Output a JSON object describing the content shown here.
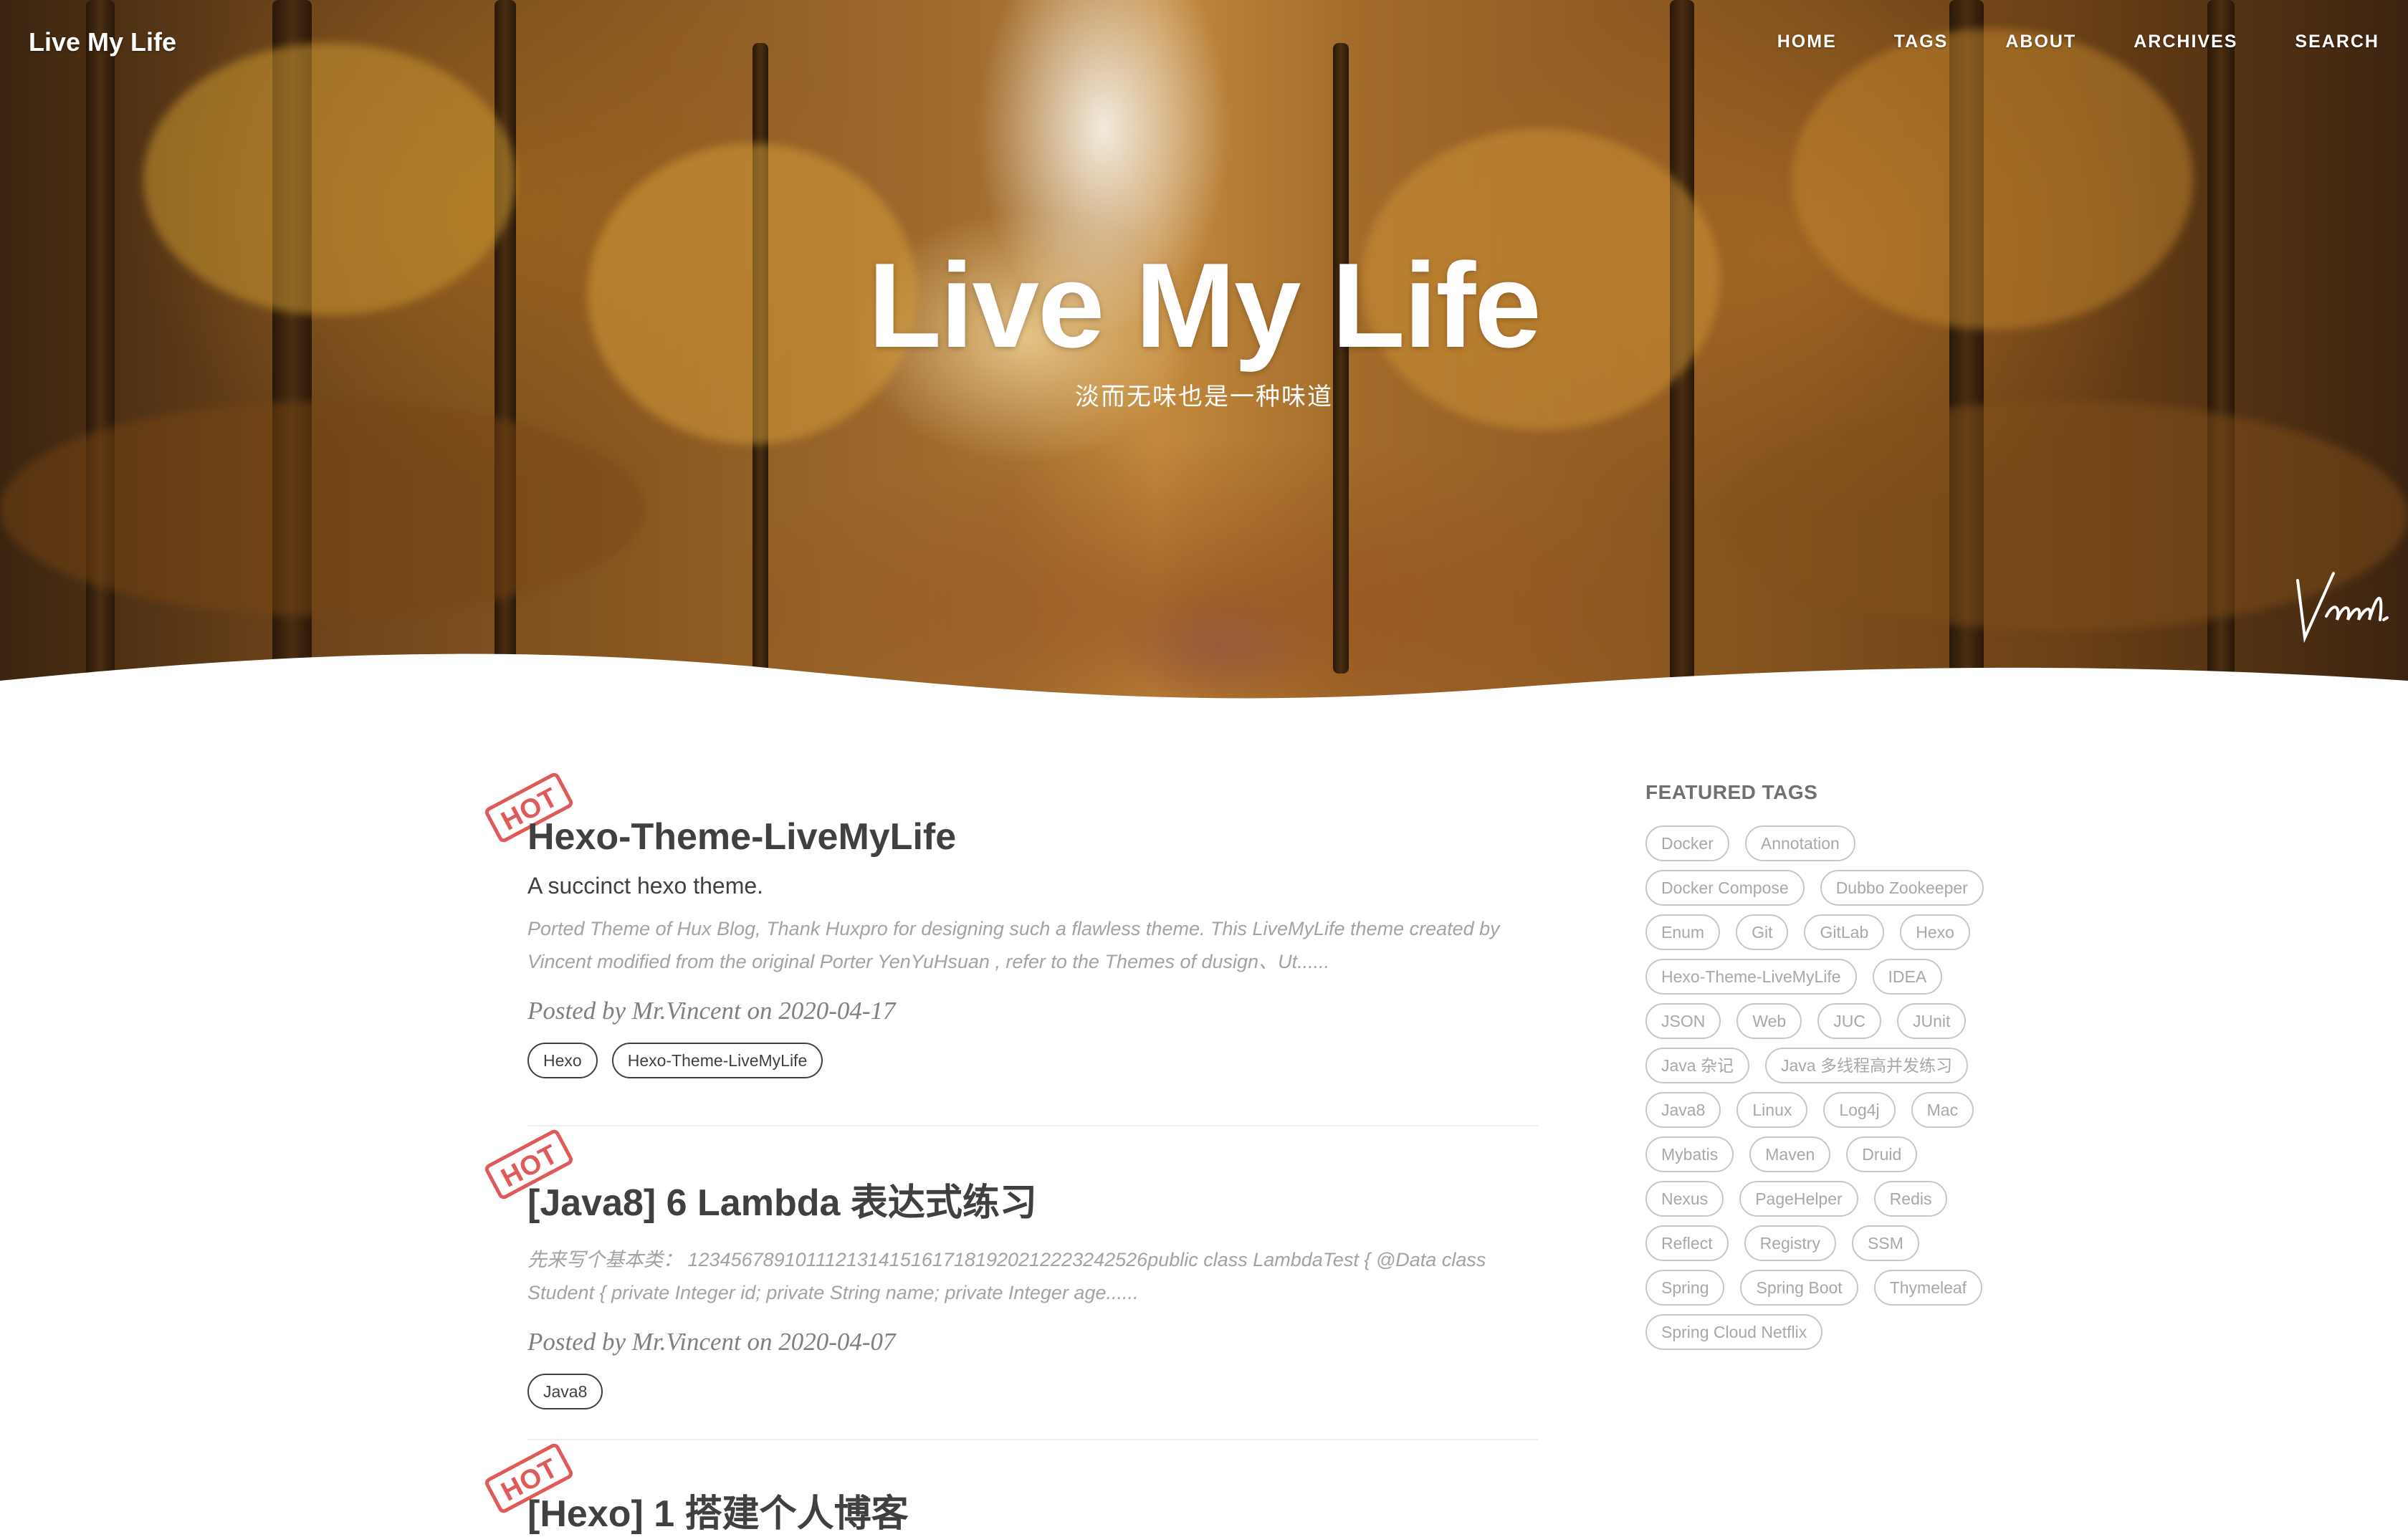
{
  "nav": {
    "brand": "Live My Life",
    "items": [
      "HOME",
      "TAGS",
      "ABOUT",
      "ARCHIVES",
      "SEARCH"
    ]
  },
  "hero": {
    "title": "Live My Life",
    "subtitle": "淡而无味也是一种味道"
  },
  "hot_badge": "HOT",
  "posts": [
    {
      "title": "Hexo-Theme-LiveMyLife",
      "subtitle": "A succinct hexo theme.",
      "excerpt": "Ported Theme of Hux Blog, Thank Huxpro for designing such a flawless theme. This LiveMyLife theme created by Vincent modified from the original Porter YenYuHsuan , refer to the Themes of dusign、Ut......",
      "meta": "Posted by Mr.Vincent on 2020-04-17",
      "tags": [
        "Hexo",
        "Hexo-Theme-LiveMyLife"
      ]
    },
    {
      "title": "[Java8] 6 Lambda 表达式练习",
      "excerpt": "先来写个基本类： 1234567891011121314151617181920212223242526public class LambdaTest { @Data class Student { private Integer id; private String name; private Integer age......",
      "meta": "Posted by Mr.Vincent on 2020-04-07",
      "tags": [
        "Java8"
      ]
    },
    {
      "title": "[Hexo] 1 搭建个人博客"
    }
  ],
  "sidebar": {
    "title": "FEATURED TAGS",
    "tags": [
      "Docker",
      "Annotation",
      "Docker Compose",
      "Dubbo Zookeeper",
      "Enum",
      "Git",
      "GitLab",
      "Hexo",
      "Hexo-Theme-LiveMyLife",
      "IDEA",
      "JSON",
      "Web",
      "JUC",
      "JUnit",
      "Java 杂记",
      "Java 多线程高并发练习",
      "Java8",
      "Linux",
      "Log4j",
      "Mac",
      "Mybatis",
      "Maven",
      "Druid",
      "Nexus",
      "PageHelper",
      "Redis",
      "Reflect",
      "Registry",
      "SSM",
      "Spring",
      "Spring Boot",
      "Thymeleaf",
      "Spring Cloud Netflix"
    ]
  }
}
